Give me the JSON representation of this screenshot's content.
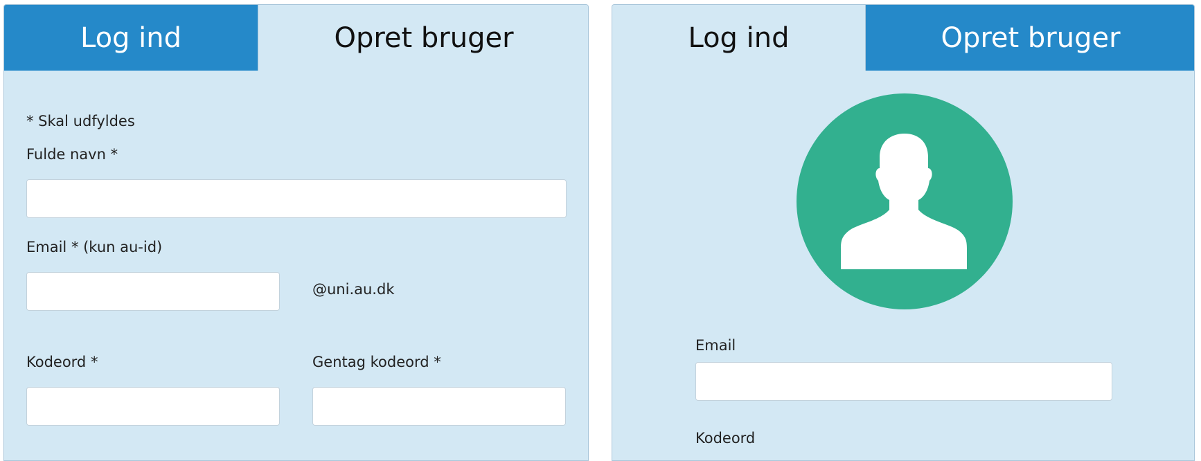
{
  "left_form": {
    "tabs": {
      "login": "Log ind",
      "signup": "Opret bruger"
    },
    "required_note": "* Skal udfyldes",
    "full_name_label": "Fulde navn *",
    "email_label": "Email * (kun au-id)",
    "email_domain": "@uni.au.dk",
    "password_label": "Kodeord *",
    "repeat_password_label": "Gentag kodeord *",
    "fields": {
      "full_name": "",
      "email": "",
      "password": "",
      "repeat_password": ""
    }
  },
  "right_form": {
    "tabs": {
      "login": "Log ind",
      "signup": "Opret bruger"
    },
    "avatar_icon": "user-avatar-icon",
    "email_label": "Email",
    "password_label": "Kodeord",
    "fields": {
      "email": ""
    }
  },
  "colors": {
    "tab_inactive": "#2589c9",
    "panel_bg": "#d3e8f4",
    "avatar": "#32b08f"
  }
}
